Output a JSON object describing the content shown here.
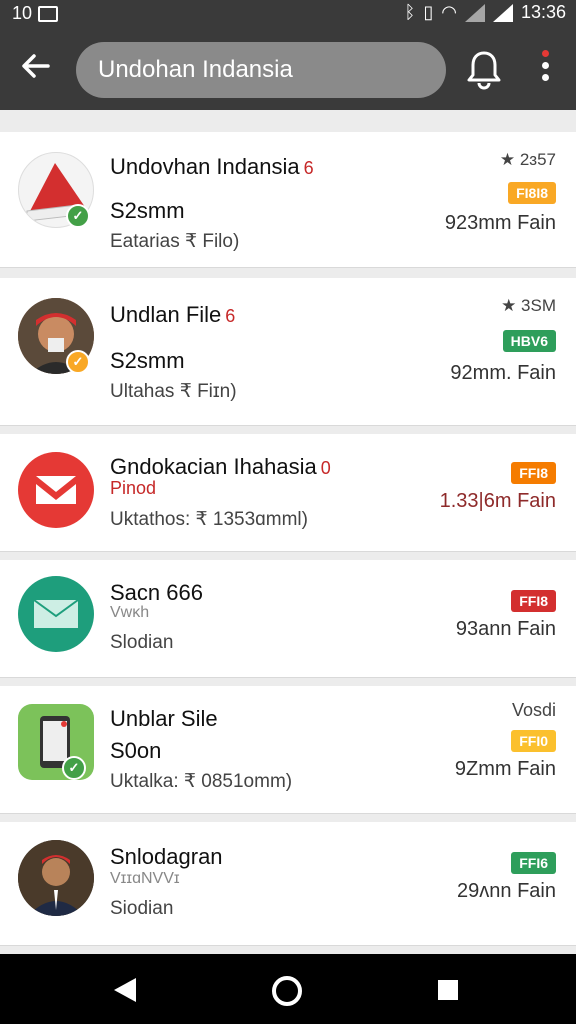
{
  "status_bar": {
    "left_text": "10",
    "time": "13:36",
    "icons": [
      "image-icon",
      "bluetooth-icon",
      "vibrate-icon",
      "wifi-icon",
      "cell-signal-icon",
      "cell-signal-icon",
      "battery-icon"
    ]
  },
  "app_bar": {
    "search_value": "Undohan Indansia",
    "back_icon": "arrow-back-icon",
    "bell_icon": "bell-icon",
    "menu_icon": "more-vertical-icon",
    "accent_color": "#e53935"
  },
  "items": [
    {
      "title": "Undovhan Indansia",
      "flag": "6",
      "subtitle": "S2smm",
      "meta": "Eatarias ₹ Filo)",
      "stat": "★ 2ɜ57",
      "tag": "FI8I8",
      "tag_color": "#f9a825",
      "distance": "923mm Fain",
      "avatar": "hat-avatar",
      "badge_color": "#43a047"
    },
    {
      "title": "Undlan File",
      "flag": "6",
      "subtitle": "S2smm",
      "meta": "Ultahas ₹ Fiɪn)",
      "stat": "★ 3SM",
      "tag": "HBV6",
      "tag_color": "#2e9e5b",
      "distance": "92mm. Fain",
      "avatar": "person-avatar",
      "badge_color": "#f9a825"
    },
    {
      "title": "Gndokacian Ihahasia",
      "flag": "0",
      "subtitle": "Pinod",
      "meta": "Uktathos: ₹ 1353ɑmml)",
      "stat": "",
      "tag": "FFI8",
      "tag_color": "#f57c00",
      "distance": "1.33|6m Fain",
      "avatar": "gmail-avatar",
      "badge_color": ""
    },
    {
      "title": "Sacn 666",
      "flag": "",
      "subtitle": "Vwĸh",
      "meta": "Slodian",
      "stat": "",
      "tag": "FFI8",
      "tag_color": "#d32f2f",
      "distance": "93ann Fain",
      "avatar": "mail-avatar",
      "badge_color": ""
    },
    {
      "title": "Unblar Sile",
      "flag": "",
      "subtitle": "S0on",
      "meta": "Uktalka: ₹ 0851omm)",
      "stat": "Vosdi",
      "tag": "FFI0",
      "tag_color": "#fbc02d",
      "distance": "9Zmm Fain",
      "avatar": "phone-avatar",
      "badge_color": "#43a047"
    },
    {
      "title": "Snlodagran",
      "flag": "",
      "subtitle": "VɪɪɑNVVɪ",
      "meta": "Siodian",
      "stat": "",
      "tag": "FFI6",
      "tag_color": "#2e9e5b",
      "distance": "29ʌnn Fain",
      "avatar": "man-avatar",
      "badge_color": ""
    }
  ]
}
